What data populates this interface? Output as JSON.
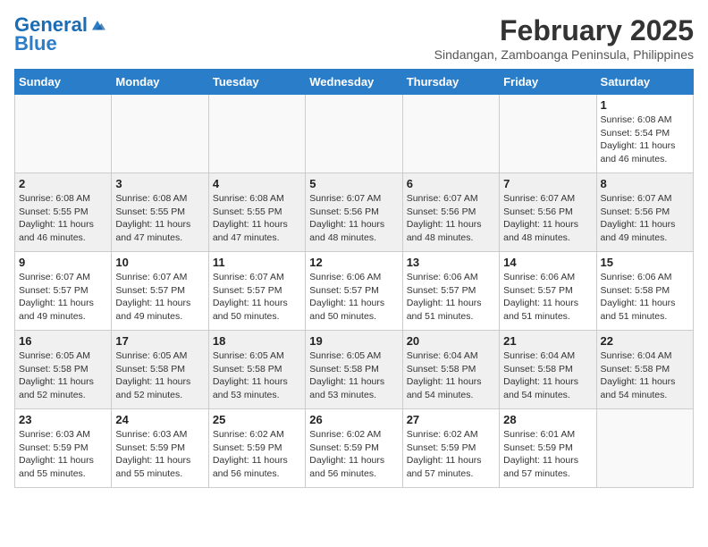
{
  "header": {
    "logo_line1": "General",
    "logo_line2": "Blue",
    "month_year": "February 2025",
    "location": "Sindangan, Zamboanga Peninsula, Philippines"
  },
  "days_of_week": [
    "Sunday",
    "Monday",
    "Tuesday",
    "Wednesday",
    "Thursday",
    "Friday",
    "Saturday"
  ],
  "weeks": [
    [
      {
        "day": "",
        "content": ""
      },
      {
        "day": "",
        "content": ""
      },
      {
        "day": "",
        "content": ""
      },
      {
        "day": "",
        "content": ""
      },
      {
        "day": "",
        "content": ""
      },
      {
        "day": "",
        "content": ""
      },
      {
        "day": "1",
        "content": "Sunrise: 6:08 AM\nSunset: 5:54 PM\nDaylight: 11 hours\nand 46 minutes."
      }
    ],
    [
      {
        "day": "2",
        "content": "Sunrise: 6:08 AM\nSunset: 5:55 PM\nDaylight: 11 hours\nand 46 minutes."
      },
      {
        "day": "3",
        "content": "Sunrise: 6:08 AM\nSunset: 5:55 PM\nDaylight: 11 hours\nand 47 minutes."
      },
      {
        "day": "4",
        "content": "Sunrise: 6:08 AM\nSunset: 5:55 PM\nDaylight: 11 hours\nand 47 minutes."
      },
      {
        "day": "5",
        "content": "Sunrise: 6:07 AM\nSunset: 5:56 PM\nDaylight: 11 hours\nand 48 minutes."
      },
      {
        "day": "6",
        "content": "Sunrise: 6:07 AM\nSunset: 5:56 PM\nDaylight: 11 hours\nand 48 minutes."
      },
      {
        "day": "7",
        "content": "Sunrise: 6:07 AM\nSunset: 5:56 PM\nDaylight: 11 hours\nand 48 minutes."
      },
      {
        "day": "8",
        "content": "Sunrise: 6:07 AM\nSunset: 5:56 PM\nDaylight: 11 hours\nand 49 minutes."
      }
    ],
    [
      {
        "day": "9",
        "content": "Sunrise: 6:07 AM\nSunset: 5:57 PM\nDaylight: 11 hours\nand 49 minutes."
      },
      {
        "day": "10",
        "content": "Sunrise: 6:07 AM\nSunset: 5:57 PM\nDaylight: 11 hours\nand 49 minutes."
      },
      {
        "day": "11",
        "content": "Sunrise: 6:07 AM\nSunset: 5:57 PM\nDaylight: 11 hours\nand 50 minutes."
      },
      {
        "day": "12",
        "content": "Sunrise: 6:06 AM\nSunset: 5:57 PM\nDaylight: 11 hours\nand 50 minutes."
      },
      {
        "day": "13",
        "content": "Sunrise: 6:06 AM\nSunset: 5:57 PM\nDaylight: 11 hours\nand 51 minutes."
      },
      {
        "day": "14",
        "content": "Sunrise: 6:06 AM\nSunset: 5:57 PM\nDaylight: 11 hours\nand 51 minutes."
      },
      {
        "day": "15",
        "content": "Sunrise: 6:06 AM\nSunset: 5:58 PM\nDaylight: 11 hours\nand 51 minutes."
      }
    ],
    [
      {
        "day": "16",
        "content": "Sunrise: 6:05 AM\nSunset: 5:58 PM\nDaylight: 11 hours\nand 52 minutes."
      },
      {
        "day": "17",
        "content": "Sunrise: 6:05 AM\nSunset: 5:58 PM\nDaylight: 11 hours\nand 52 minutes."
      },
      {
        "day": "18",
        "content": "Sunrise: 6:05 AM\nSunset: 5:58 PM\nDaylight: 11 hours\nand 53 minutes."
      },
      {
        "day": "19",
        "content": "Sunrise: 6:05 AM\nSunset: 5:58 PM\nDaylight: 11 hours\nand 53 minutes."
      },
      {
        "day": "20",
        "content": "Sunrise: 6:04 AM\nSunset: 5:58 PM\nDaylight: 11 hours\nand 54 minutes."
      },
      {
        "day": "21",
        "content": "Sunrise: 6:04 AM\nSunset: 5:58 PM\nDaylight: 11 hours\nand 54 minutes."
      },
      {
        "day": "22",
        "content": "Sunrise: 6:04 AM\nSunset: 5:58 PM\nDaylight: 11 hours\nand 54 minutes."
      }
    ],
    [
      {
        "day": "23",
        "content": "Sunrise: 6:03 AM\nSunset: 5:59 PM\nDaylight: 11 hours\nand 55 minutes."
      },
      {
        "day": "24",
        "content": "Sunrise: 6:03 AM\nSunset: 5:59 PM\nDaylight: 11 hours\nand 55 minutes."
      },
      {
        "day": "25",
        "content": "Sunrise: 6:02 AM\nSunset: 5:59 PM\nDaylight: 11 hours\nand 56 minutes."
      },
      {
        "day": "26",
        "content": "Sunrise: 6:02 AM\nSunset: 5:59 PM\nDaylight: 11 hours\nand 56 minutes."
      },
      {
        "day": "27",
        "content": "Sunrise: 6:02 AM\nSunset: 5:59 PM\nDaylight: 11 hours\nand 57 minutes."
      },
      {
        "day": "28",
        "content": "Sunrise: 6:01 AM\nSunset: 5:59 PM\nDaylight: 11 hours\nand 57 minutes."
      },
      {
        "day": "",
        "content": ""
      }
    ]
  ]
}
